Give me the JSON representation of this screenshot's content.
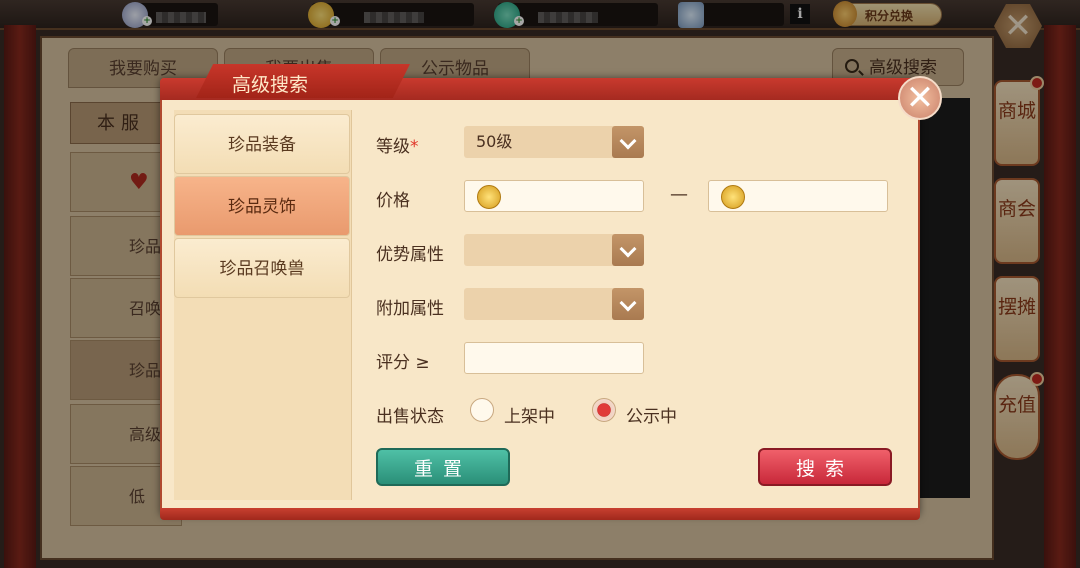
{
  "topbar": {
    "exchange_label": "积分兑换",
    "info_label": "i",
    "plus": "+"
  },
  "back": {
    "tabs": [
      "我要购买",
      "我要出售",
      "公示物品"
    ],
    "adv_search_label": "高级搜索",
    "server_label": "本服",
    "left_items": [
      "珍品",
      "召唤",
      "珍品",
      "高级",
      "低"
    ]
  },
  "sidenav": [
    "商城",
    "商会",
    "摆摊",
    "充值"
  ],
  "close_glyph": "✕",
  "modal": {
    "title": "高级搜索",
    "categories": [
      "珍品装备",
      "珍品灵饰",
      "珍品召唤兽"
    ],
    "level_label": "等级",
    "required_mark": "*",
    "level_value": "50级",
    "price_label": "价格",
    "price_separator": "—",
    "advantage_label": "优势属性",
    "extra_label": "附加属性",
    "score_label": "评分 ≥",
    "status_label": "出售状态",
    "status_options": [
      "上架中",
      "公示中"
    ],
    "status_selected": "公示中",
    "reset_label": "重置",
    "search_label": "搜索"
  }
}
